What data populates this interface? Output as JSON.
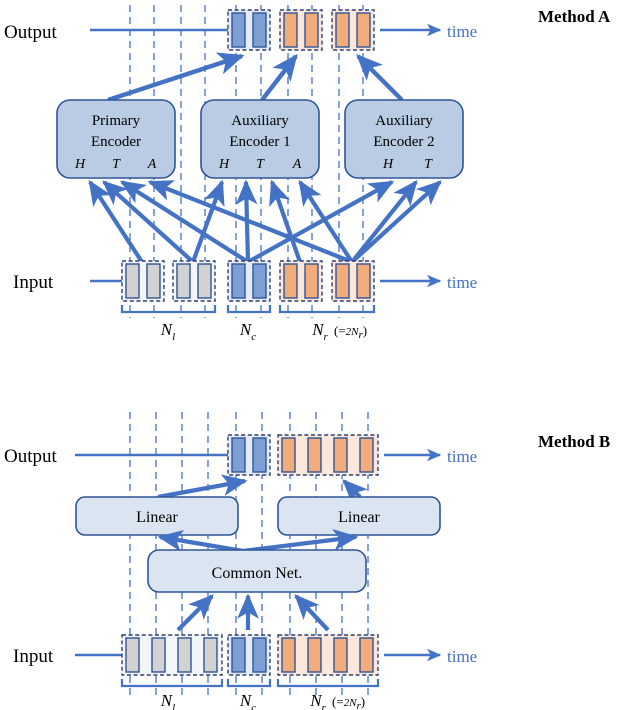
{
  "figure": {
    "type": "architecture-diagram",
    "panels": [
      {
        "id": "method-a",
        "title": "Method A",
        "row_labels": {
          "output": "Output",
          "input": "Input"
        },
        "axis_label": "time",
        "output_groups": [
          {
            "color": "blue",
            "bars": 2
          },
          {
            "color": "orange",
            "bars": 2
          },
          {
            "color": "orange",
            "bars": 2
          }
        ],
        "input_groups": [
          {
            "color": "gray",
            "bars": 2
          },
          {
            "color": "gray",
            "bars": 2
          },
          {
            "color": "blue",
            "bars": 2
          },
          {
            "color": "orange",
            "bars": 2
          },
          {
            "color": "orange",
            "bars": 2
          }
        ],
        "modules": [
          {
            "line1": "Primary",
            "line2": "Encoder",
            "tokens": [
              "H",
              "T",
              "A"
            ]
          },
          {
            "line1": "Auxiliary",
            "line2": "Encoder 1",
            "tokens": [
              "H",
              "T",
              "A"
            ]
          },
          {
            "line1": "Auxiliary",
            "line2": "Encoder 2",
            "tokens": [
              "H",
              "T"
            ]
          }
        ],
        "brackets": [
          {
            "symbol": "N",
            "sub": "l",
            "note": ""
          },
          {
            "symbol": "N",
            "sub": "c",
            "note": ""
          },
          {
            "symbol": "N",
            "sub": "r",
            "note": "(= 2N_r)",
            "note_main": "(=",
            "note_num": "2",
            "note_sym": "N",
            "note_sub": "r",
            "note_end": ")"
          }
        ]
      },
      {
        "id": "method-b",
        "title": "Method B",
        "row_labels": {
          "output": "Output",
          "input": "Input"
        },
        "axis_label": "time",
        "output_groups": [
          {
            "color": "blue",
            "bars": 2
          },
          {
            "color": "orange",
            "bars": 4
          }
        ],
        "input_groups": [
          {
            "color": "gray",
            "bars": 4
          },
          {
            "color": "blue",
            "bars": 2
          },
          {
            "color": "orange",
            "bars": 4
          }
        ],
        "modules": [
          {
            "line1": "Linear"
          },
          {
            "line1": "Linear"
          },
          {
            "line1": "Common Net."
          }
        ],
        "brackets": [
          {
            "symbol": "N",
            "sub": "l",
            "note": ""
          },
          {
            "symbol": "N",
            "sub": "c",
            "note": ""
          },
          {
            "symbol": "N",
            "sub": "r",
            "note": "(= 2N_r)",
            "note_main": "(=",
            "note_num": "2",
            "note_sym": "N",
            "note_sub": "r",
            "note_end": ")"
          }
        ]
      }
    ],
    "colors": {
      "bar_blue": "#7d9fd3",
      "bar_orange": "#f2ac7c",
      "bar_gray": "#d2d2d2",
      "bar_stroke": "#2f5597",
      "group_blue_bg": "#e5ecf7",
      "group_orange_bg": "#fbe7dc",
      "group_gray_bg": "#f2f5fa",
      "encoder_fill": "#b9cce4",
      "linear_fill": "#dbe5f1",
      "arrow": "#4472c4",
      "dashed": "#4472c4",
      "accent_text": "#4472c4"
    }
  }
}
